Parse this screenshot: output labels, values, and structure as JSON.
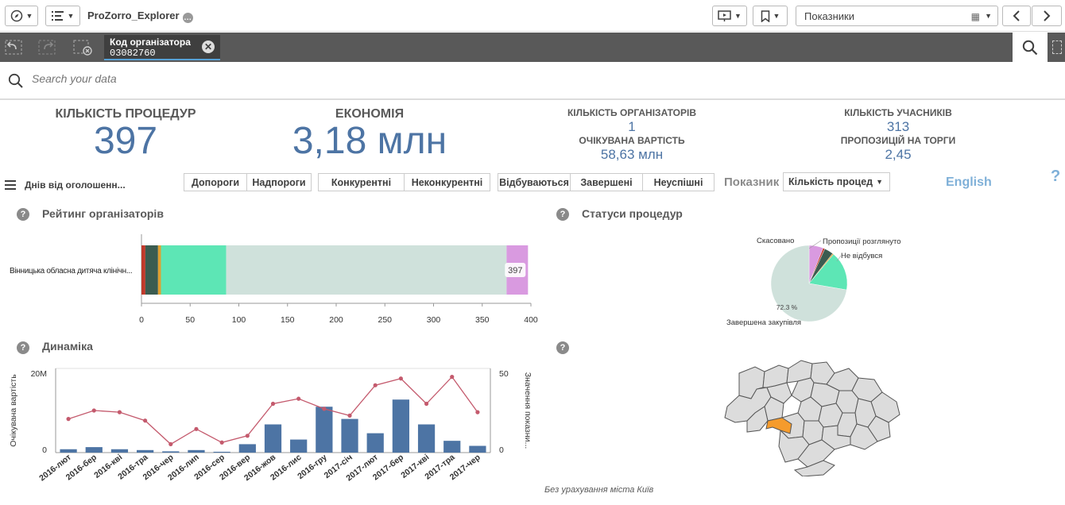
{
  "app": {
    "title": "ProZorro_Explorer"
  },
  "sheet_selector": {
    "label": "Показники"
  },
  "selection": {
    "field": "Код організатора",
    "value": "03082760"
  },
  "search": {
    "placeholder": "Search your data"
  },
  "kpis": {
    "procedures": {
      "label": "КІЛЬКІСТЬ ПРОЦЕДУР",
      "value": "397"
    },
    "economy": {
      "label": "ЕКОНОМІЯ",
      "value": "3,18 млн"
    },
    "organizers": {
      "label": "КІЛЬКІСТЬ ОРГАНІЗАТОРІВ",
      "value": "1"
    },
    "expected": {
      "label": "ОЧІКУВАНА ВАРТІСТЬ",
      "value": "58,63 млн"
    },
    "participants": {
      "label": "КІЛЬКІСТЬ УЧАСНИКІВ",
      "value": "313"
    },
    "proposals": {
      "label": "ПРОПОЗИЦІЙ НА ТОРГИ",
      "value": "2,45"
    }
  },
  "filters": {
    "days_label": "Днів від оголошенн...",
    "threshold": [
      "Допороги",
      "Надпороги"
    ],
    "competition": [
      "Конкурентні",
      "Неконкурентні"
    ],
    "status": [
      "Відбуваються",
      "Завершені",
      "Неуспішні"
    ],
    "indicator_label": "Показник",
    "indicator_value": "Кількість процед",
    "language": "English",
    "help": "?"
  },
  "colors": {
    "accent": "#4d74a4",
    "line": "#c45a6d",
    "highlight": "#f59b2c"
  },
  "panels": {
    "rating_title": "Рейтинг організаторів",
    "status_title": "Статуси процедур",
    "dynamics_title": "Динаміка",
    "map_caption": "Без урахування міста Київ"
  },
  "chart_data": [
    {
      "type": "bar",
      "orientation": "horizontal",
      "stacked": true,
      "categories": [
        "Вінницька обласна дитяча клінічн..."
      ],
      "segment_colors": [
        "#c0392b",
        "#3b5c50",
        "#e0a030",
        "#5de6b5",
        "#cfe1db",
        "#d99ae0"
      ],
      "segments": [
        4,
        13,
        3,
        67,
        288,
        22
      ],
      "total_label": "397",
      "x_ticks": [
        "0",
        "50",
        "100",
        "150",
        "200",
        "250",
        "300",
        "350",
        "400"
      ],
      "xlim": [
        0,
        400
      ]
    },
    {
      "type": "pie",
      "slices": [
        {
          "label": "Завершена закупівля",
          "value": 72.3,
          "color": "#cfe1db"
        },
        {
          "label": "Не відбувся",
          "value": 16.6,
          "color": "#5de6b5"
        },
        {
          "label": "",
          "value": 0.5,
          "color": "#e0a030"
        },
        {
          "label": "Пропозиції розглянуто",
          "value": 3.8,
          "color": "#3b5c50"
        },
        {
          "label": "",
          "value": 0.8,
          "color": "#c0392b"
        },
        {
          "label": "Скасовано",
          "value": 6.0,
          "color": "#d99ae0"
        }
      ],
      "center_label": "72.3 %"
    },
    {
      "type": "bar",
      "categories": [
        "2016-лют",
        "2016-бер",
        "2016-кві",
        "2016-тра",
        "2016-чер",
        "2016-лип",
        "2016-сер",
        "2016-вер",
        "2016-жов",
        "2016-лис",
        "2016-гру",
        "2017-січ",
        "2017-лют",
        "2017-бер",
        "2017-кві",
        "2017-тра",
        "2017-чер"
      ],
      "series": [
        {
          "type": "bar",
          "values": [
            0.8,
            1.3,
            0.8,
            0.6,
            0.3,
            0.6,
            0.2,
            2.0,
            6.7,
            3.1,
            10.9,
            8.0,
            4.6,
            12.6,
            6.7,
            2.8,
            1.6
          ]
        },
        {
          "type": "line",
          "values": [
            20,
            25,
            24,
            19,
            5,
            14,
            6,
            10,
            29,
            32,
            26,
            22,
            40,
            44,
            29,
            45,
            24
          ]
        }
      ],
      "ylabel": "Очікувана вартість",
      "y2label": "Значення показни...",
      "y_ticks": [
        "20M",
        "0"
      ],
      "y2_ticks": [
        "50",
        "0"
      ],
      "ylim": [
        0,
        20
      ],
      "y2lim": [
        0,
        50
      ]
    }
  ],
  "map": {
    "highlighted_region": "Вінницька",
    "regions": 25
  }
}
